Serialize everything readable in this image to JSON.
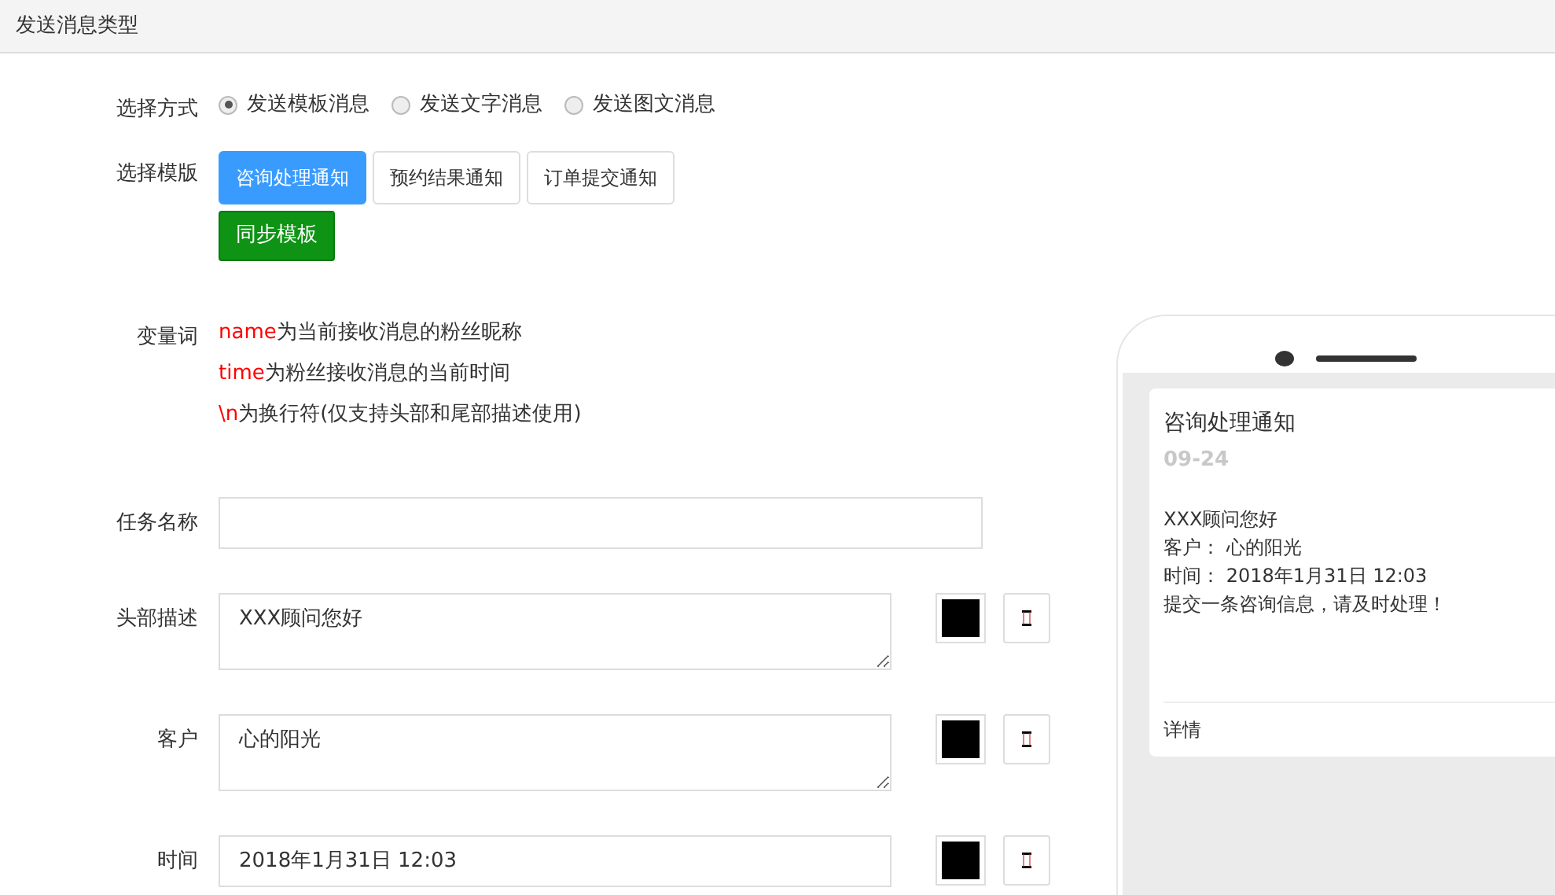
{
  "header": {
    "title": "发送消息类型"
  },
  "send_mode": {
    "label": "选择方式",
    "options": [
      {
        "label": "发送模板消息",
        "selected": true
      },
      {
        "label": "发送文字消息",
        "selected": false
      },
      {
        "label": "发送图文消息",
        "selected": false
      }
    ]
  },
  "template": {
    "label": "选择模版",
    "tabs": [
      {
        "label": "咨询处理通知",
        "selected": true
      },
      {
        "label": "预约结果通知",
        "selected": false
      },
      {
        "label": "订单提交通知",
        "selected": false
      }
    ],
    "sync_button": "同步模板"
  },
  "variables": {
    "label": "变量词",
    "items": [
      {
        "token": "name",
        "text": "为当前接收消息的粉丝昵称"
      },
      {
        "token": "time",
        "text": "为粉丝接收消息的当前时间"
      },
      {
        "token": "\\n",
        "text": "为换行符(仅支持头部和尾部描述使用)"
      }
    ]
  },
  "fields": [
    {
      "kind": "input",
      "label": "任务名称"
    },
    {
      "kind": "textarea",
      "label": "头部描述",
      "value": "XXX顾问您好",
      "color": "#000000"
    },
    {
      "kind": "textarea",
      "label": "客户",
      "value": "心的阳光",
      "color": "#000000"
    },
    {
      "kind": "input",
      "label": "时间",
      "value": "2018年1月31日 12:03",
      "color": "#000000"
    }
  ],
  "preview": {
    "title": "咨询处理通知",
    "date": "09-24",
    "lines": [
      "XXX顾问您好",
      "客户： 心的阳光",
      "时间： 2018年1月31日 12:03",
      "提交一条咨询信息，请及时处理！"
    ],
    "footer": "详情"
  }
}
